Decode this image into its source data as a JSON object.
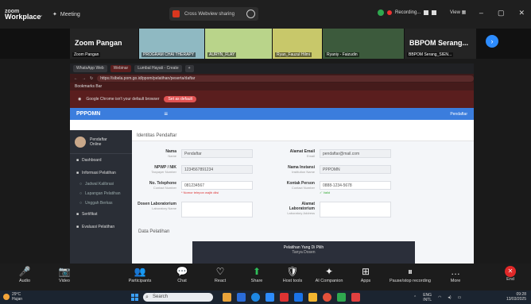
{
  "zoom": {
    "brand_top": "zoom",
    "brand_bottom": "Workplace",
    "meeting_label": "Meeting",
    "share_text": "Cross Webview sharing",
    "recording_text": "Recording...",
    "view_label": "View",
    "colors": {
      "accent": "#2d8cff",
      "end": "#e02828",
      "share": "#d9371f"
    }
  },
  "participants": [
    {
      "big": "Zoom Pangan",
      "name": "Zoom Pangan"
    },
    {
      "big": "",
      "name": "PROGRAM CHAI THERAPY"
    },
    {
      "big": "",
      "name": "AURYN_FLAY"
    },
    {
      "big": "",
      "name": "Ryan_Fauzul Hilmi"
    },
    {
      "big": "",
      "name": "Ryaniy - Faizudin"
    },
    {
      "big": "BBPOM Serang...",
      "name": "BBPOM Serang_SIEN..."
    }
  ],
  "browser": {
    "tabs": [
      "WhatsApp Web",
      "Webinar",
      "Lumbal Hayati - Create",
      "+"
    ],
    "url": "https://sibela.pom.go.id/ppom/pelatihan/peserta/daftar",
    "bookmark": "Bookmarks Bar",
    "warning": "Google Chrome isn't your default browser",
    "warning_button": "Set as default"
  },
  "app": {
    "logo": "PPPOMN",
    "menu_icon": "≡",
    "user": "Pendaftar",
    "profile_name": "Pendaftar",
    "profile_sub": "Online",
    "sidebar": [
      {
        "label": "Dashboard",
        "sub": false
      },
      {
        "label": "Informasi Pelatihan",
        "sub": false
      },
      {
        "label": "Jadwal Kalibrasi",
        "sub": true
      },
      {
        "label": "Lapangan Pelatihan",
        "sub": true
      },
      {
        "label": "Unggah Berkas",
        "sub": true
      },
      {
        "label": "Sertifikat",
        "sub": false
      },
      {
        "label": "Evaluasi Pelatihan",
        "sub": false
      }
    ],
    "page_title": "Identitas Pendaftar",
    "fields": {
      "nama": {
        "label": "Nama",
        "sub": "Name",
        "value": "Pendaftar"
      },
      "nip": {
        "label": "NPWP / NIK",
        "sub": "Taxpayer Number",
        "value": "1234567891234"
      },
      "telp": {
        "label": "No. Telephone",
        "sub": "Contact Number",
        "value": "081234567",
        "error": "* Nomor telepon wajib diisi"
      },
      "email": {
        "label": "Alamat Email",
        "sub": "Email",
        "value": "pendaftar@mail.com"
      },
      "instansi": {
        "label": "Nama Instansi",
        "sub": "Institution Name",
        "value": "PPPOMN"
      },
      "kontak": {
        "label": "Kontak Person",
        "sub": "Contact Number",
        "value": "0888-1234-5678",
        "ok": "✓ Valid"
      },
      "dosen": {
        "label": "Dosen Laboratorium",
        "sub": "Laboratory Name",
        "value": ""
      },
      "alamat": {
        "label": "Alamat Laboratorium",
        "sub": "Laboratory Address",
        "value": ""
      }
    },
    "section": "Data Pelatihan",
    "card_title": "Pelatihan Yang Di Pilih",
    "card_sub": "Tanya Dosen"
  },
  "toolbar": [
    {
      "label": "Audio",
      "icon": "🎤"
    },
    {
      "label": "Video",
      "icon": "📷"
    },
    {
      "label": "Participants",
      "icon": "👥"
    },
    {
      "label": "Chat",
      "icon": "💬"
    },
    {
      "label": "React",
      "icon": "♡"
    },
    {
      "label": "Share",
      "icon": "⬆"
    },
    {
      "label": "Host tools",
      "icon": "🛡"
    },
    {
      "label": "AI Companion",
      "icon": "✦"
    },
    {
      "label": "Apps",
      "icon": "⊞"
    },
    {
      "label": "Pause/stop recording",
      "icon": "⏸"
    },
    {
      "label": "More",
      "icon": "…"
    },
    {
      "label": "End",
      "icon": "✕"
    }
  ],
  "taskbar": {
    "temp": "29°C",
    "weather": "Hujan",
    "search_placeholder": "Search",
    "lang": "ENG",
    "lang2": "INTL",
    "time": "09:28",
    "date": "13/03/2025"
  }
}
